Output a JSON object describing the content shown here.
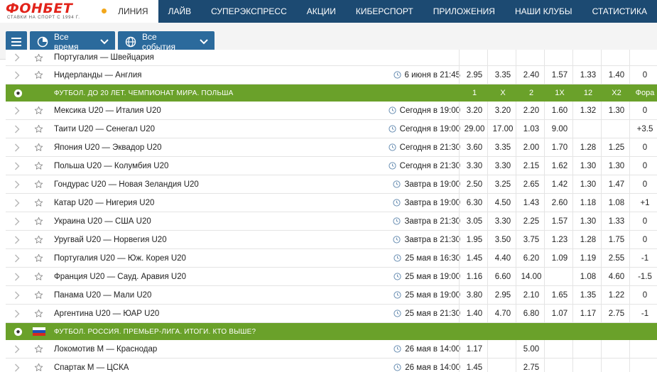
{
  "brand": {
    "name": "ФОНБЕТ",
    "tagline": "СТАВКИ НА СПОРТ С 1994 Г."
  },
  "nav": [
    "ЛИНИЯ",
    "ЛАЙВ",
    "СУПЕРЭКСПРЕСС",
    "АКЦИИ",
    "КИБЕРСПОРТ",
    "ПРИЛОЖЕНИЯ",
    "НАШИ КЛУБЫ",
    "СТАТИСТИКА"
  ],
  "filters": {
    "period": "Все время",
    "events": "Все события"
  },
  "columns": [
    "1",
    "X",
    "2",
    "1X",
    "12",
    "X2",
    "Фора"
  ],
  "top_rows": [
    {
      "name": "Португалия — Швейцария",
      "time": "",
      "odds": [
        "",
        "",
        "",
        "",
        "",
        "",
        ""
      ],
      "partial": true
    },
    {
      "name": "Нидерланды — Англия",
      "time": "6 июня в 21:45",
      "odds": [
        "2.95",
        "3.35",
        "2.40",
        "1.57",
        "1.33",
        "1.40",
        "0"
      ]
    }
  ],
  "groups": [
    {
      "title": "ФУТБОЛ. ДО 20 ЛЕТ. ЧЕМПИОНАТ МИРА. ПОЛЬША",
      "show_columns": true,
      "rows": [
        {
          "name": "Мексика U20 — Италия U20",
          "time": "Сегодня в 19:00",
          "odds": [
            "3.20",
            "3.20",
            "2.20",
            "1.60",
            "1.32",
            "1.30",
            "0"
          ]
        },
        {
          "name": "Таити U20 — Сенегал U20",
          "time": "Сегодня в 19:00",
          "odds": [
            "29.00",
            "17.00",
            "1.03",
            "9.00",
            "",
            "",
            "+3.5"
          ]
        },
        {
          "name": "Япония U20 — Эквадор U20",
          "time": "Сегодня в 21:30",
          "odds": [
            "3.60",
            "3.35",
            "2.00",
            "1.70",
            "1.28",
            "1.25",
            "0"
          ]
        },
        {
          "name": "Польша U20 — Колумбия U20",
          "time": "Сегодня в 21:30",
          "odds": [
            "3.30",
            "3.30",
            "2.15",
            "1.62",
            "1.30",
            "1.30",
            "0"
          ]
        },
        {
          "name": "Гондурас U20 — Новая Зеландия U20",
          "time": "Завтра в 19:00",
          "odds": [
            "2.50",
            "3.25",
            "2.65",
            "1.42",
            "1.30",
            "1.47",
            "0"
          ]
        },
        {
          "name": "Катар U20 — Нигерия U20",
          "time": "Завтра в 19:00",
          "odds": [
            "6.30",
            "4.50",
            "1.43",
            "2.60",
            "1.18",
            "1.08",
            "+1"
          ]
        },
        {
          "name": "Украина U20 — США U20",
          "time": "Завтра в 21:30",
          "odds": [
            "3.05",
            "3.30",
            "2.25",
            "1.57",
            "1.30",
            "1.33",
            "0"
          ]
        },
        {
          "name": "Уругвай U20 — Норвегия U20",
          "time": "Завтра в 21:30",
          "odds": [
            "1.95",
            "3.50",
            "3.75",
            "1.23",
            "1.28",
            "1.75",
            "0"
          ]
        },
        {
          "name": "Португалия U20 — Юж. Корея U20",
          "time": "25 мая в 16:30",
          "odds": [
            "1.45",
            "4.40",
            "6.20",
            "1.09",
            "1.19",
            "2.55",
            "-1"
          ]
        },
        {
          "name": "Франция U20 — Сауд. Аравия U20",
          "time": "25 мая в 19:00",
          "odds": [
            "1.16",
            "6.60",
            "14.00",
            "",
            "1.08",
            "4.60",
            "-1.5"
          ]
        },
        {
          "name": "Панама U20 — Мали U20",
          "time": "25 мая в 19:00",
          "odds": [
            "3.80",
            "2.95",
            "2.10",
            "1.65",
            "1.35",
            "1.22",
            "0"
          ]
        },
        {
          "name": "Аргентина U20 — ЮАР U20",
          "time": "25 мая в 21:30",
          "odds": [
            "1.40",
            "4.70",
            "6.80",
            "1.07",
            "1.17",
            "2.75",
            "-1"
          ]
        }
      ]
    },
    {
      "title": "ФУТБОЛ. РОССИЯ. ПРЕМЬЕР-ЛИГА. ИТОГИ. КТО ВЫШЕ?",
      "show_columns": false,
      "flag": "russia-flag",
      "rows": [
        {
          "name": "Локомотив М — Краснодар",
          "time": "26 мая в 14:00",
          "odds": [
            "1.17",
            "",
            "5.00",
            "",
            "",
            "",
            ""
          ]
        },
        {
          "name": "Спартак М — ЦСКА",
          "time": "26 мая в 14:00",
          "odds": [
            "1.45",
            "",
            "2.75",
            "",
            "",
            "",
            ""
          ]
        }
      ]
    }
  ],
  "colors": {
    "nav_bg": "#1c4a72",
    "group_header": "#6aa12a",
    "button_blue": "#2b6a9c",
    "brand_red": "#e2231a"
  }
}
